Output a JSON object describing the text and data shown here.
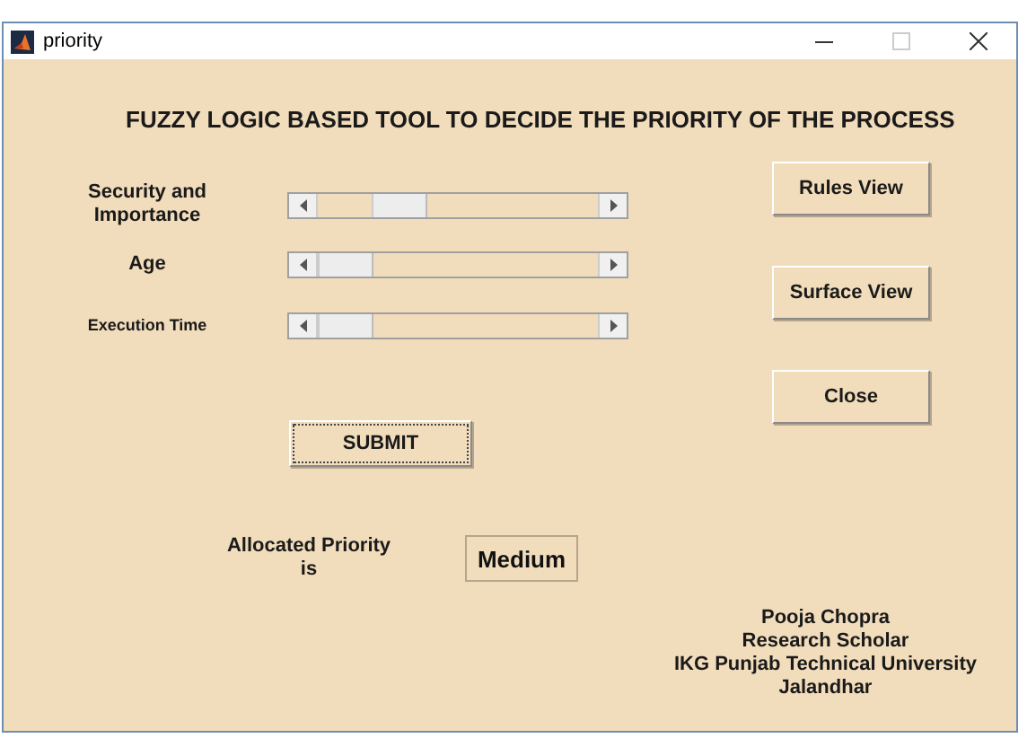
{
  "window": {
    "title": "priority"
  },
  "heading": "FUZZY LOGIC BASED TOOL TO DECIDE THE PRIORITY OF THE PROCESS",
  "sliders": [
    {
      "label": "Security and Importance",
      "level": 0.24,
      "small": false
    },
    {
      "label": "Age",
      "level": 0,
      "small": false
    },
    {
      "label": "Execution Time",
      "level": 0,
      "small": true
    }
  ],
  "side_buttons": [
    "Rules View",
    "Surface View",
    "Close"
  ],
  "submit": {
    "label": "SUBMIT",
    "focused": true
  },
  "result": {
    "label": "Allocated Priority is",
    "value": "Medium"
  },
  "credits": [
    "Pooja Chopra",
    "Research Scholar",
    "IKG Punjab Technical University",
    "Jalandhar"
  ]
}
